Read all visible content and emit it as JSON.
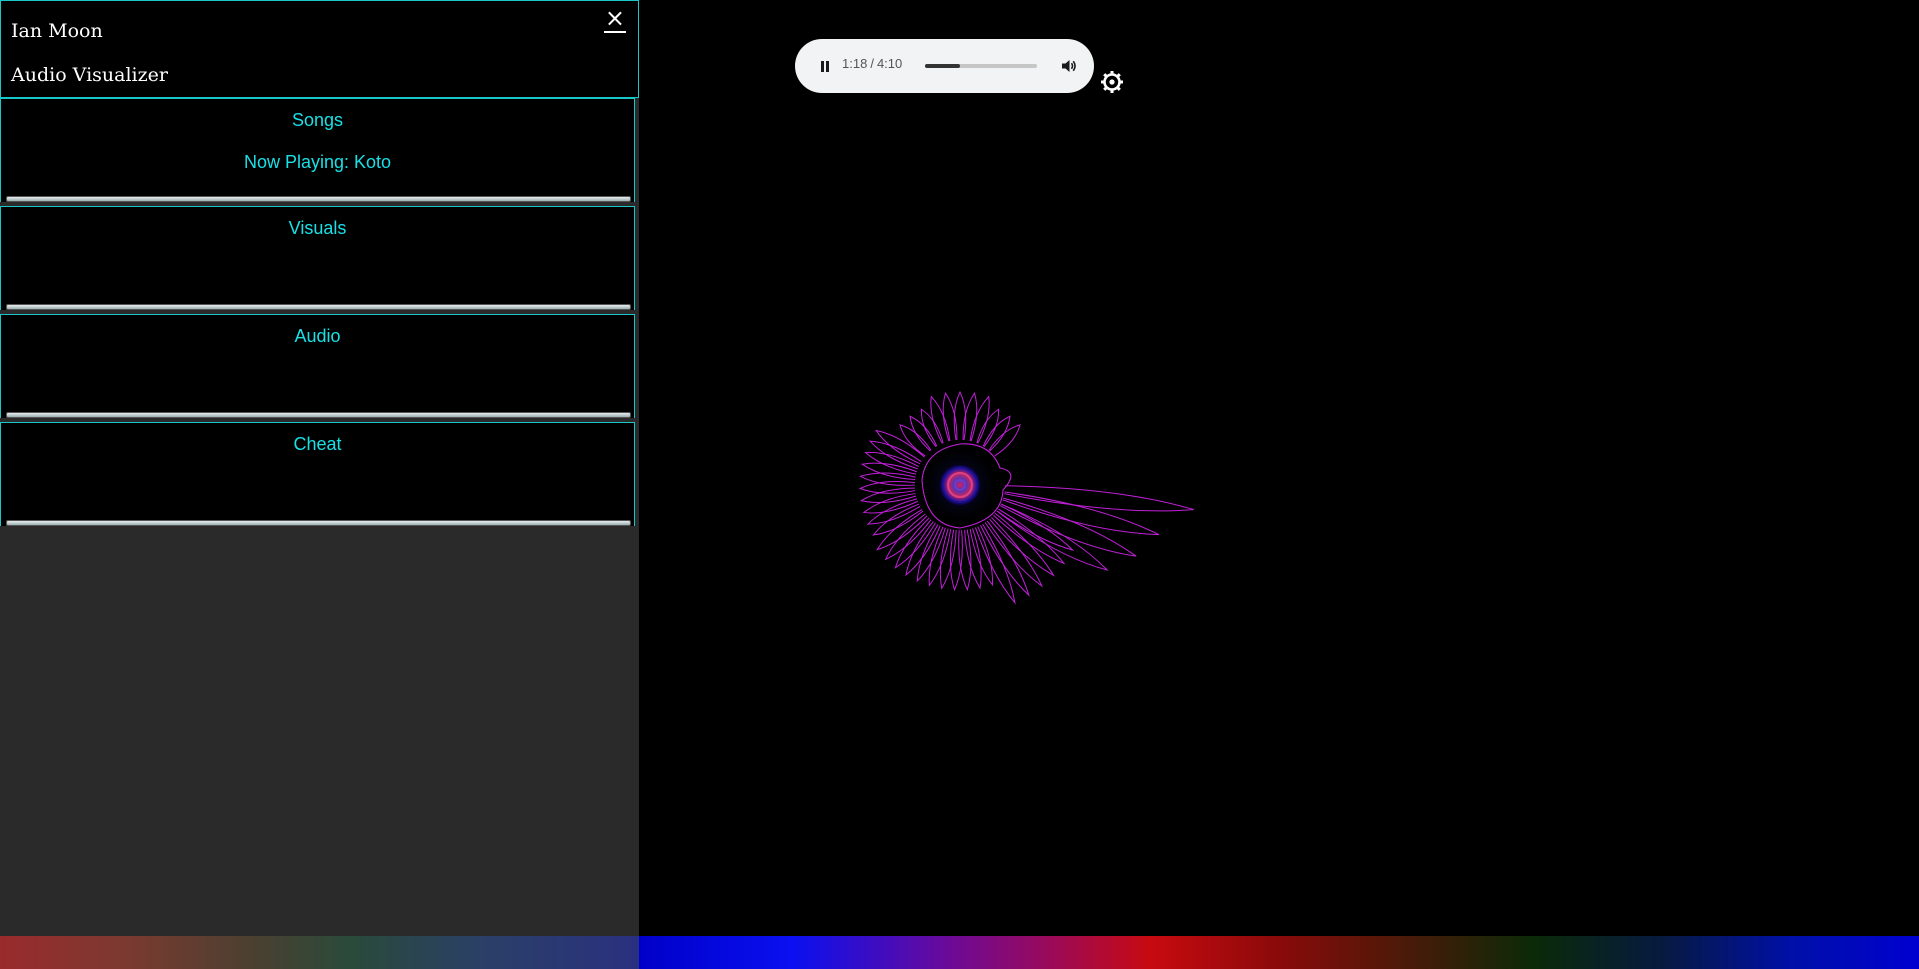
{
  "header": {
    "line1": "Ian Moon",
    "line2": "Audio Visualizer",
    "close_label": "×"
  },
  "sections": [
    {
      "title": "Songs",
      "subtitle": "Now Playing: Koto"
    },
    {
      "title": "Visuals"
    },
    {
      "title": "Audio"
    },
    {
      "title": "Cheat"
    }
  ],
  "player": {
    "current_time": "1:18",
    "separator": "/",
    "duration": "4:10",
    "progress_fraction": 0.31,
    "state": "playing",
    "play_icon": "pause-icon",
    "volume_icon": "volume-icon"
  },
  "settings": {
    "icon": "settings-icon"
  },
  "colors": {
    "accent": "#19e0e6",
    "panel_border": "#19c6c8",
    "visualizer_stroke": "#c020d8",
    "panel_fill": "#2a2a2a"
  }
}
